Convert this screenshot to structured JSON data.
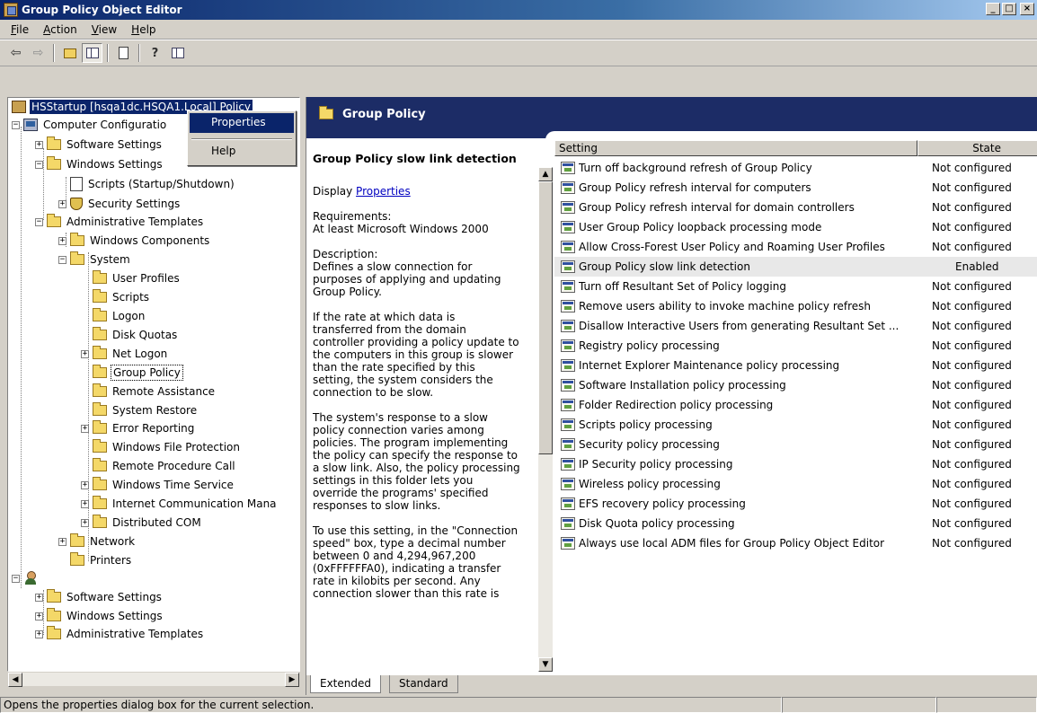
{
  "window": {
    "title": "Group Policy Object Editor",
    "controls": [
      "_",
      "□",
      "×"
    ]
  },
  "menu": [
    {
      "label": "File",
      "accel": "F",
      "rest": "ile"
    },
    {
      "label": "Action",
      "accel": "A",
      "rest": "ction"
    },
    {
      "label": "View",
      "accel": "V",
      "rest": "iew"
    },
    {
      "label": "Help",
      "accel": "H",
      "rest": "elp"
    }
  ],
  "toolbar": {
    "back": "⇦",
    "forward": "⇨",
    "up_icon": "folder-up-icon",
    "show_hide_tree_icon": "show-hide-console-tree-icon",
    "export_icon": "export-list-icon",
    "help_icon": "help-icon",
    "pane_icon": "show-hide-action-pane-icon"
  },
  "tree": {
    "root": "HSStartup [hsqa1dc.HSQA1.Local] Policy",
    "computer_configuration": "Computer Configuratio",
    "nodes": {
      "software_settings": "Software Settings",
      "windows_settings": "Windows Settings",
      "scripts_startup": "Scripts (Startup/Shutdown)",
      "security_settings": "Security Settings",
      "administrative_templates": "Administrative Templates",
      "windows_components": "Windows Components",
      "system": "System",
      "user_profiles": "User Profiles",
      "scripts": "Scripts",
      "logon": "Logon",
      "disk_quotas": "Disk Quotas",
      "net_logon": "Net Logon",
      "group_policy": "Group Policy",
      "remote_assistance": "Remote Assistance",
      "system_restore": "System Restore",
      "error_reporting": "Error Reporting",
      "windows_file_protection": "Windows File Protection",
      "remote_procedure_call": "Remote Procedure Call",
      "windows_time_service": "Windows Time Service",
      "internet_communication": "Internet Communication Mana",
      "distributed_com": "Distributed COM",
      "network": "Network",
      "printers": "Printers",
      "user_configuration": "User Configuration",
      "user_software_settings": "Software Settings",
      "user_windows_settings": "Windows Settings",
      "user_administrative_templates": "Administrative Templates"
    }
  },
  "context_menu": {
    "properties": "Properties",
    "help": "Help"
  },
  "right_pane": {
    "banner_title": "Group Policy",
    "description": {
      "title": "Group Policy slow link detection",
      "display_prefix": "Display ",
      "display_link": "Properties",
      "requirements": "Requirements:\nAt least Microsoft Windows 2000",
      "description": "Description:\nDefines a slow connection for\npurposes of applying and updating\nGroup Policy.",
      "para2": "If the rate at which data is\ntransferred from the domain\ncontroller providing a policy update to\nthe computers in this group is slower\nthan the rate specified by this\nsetting, the system considers the\nconnection to be slow.",
      "para3": "The system's response to a slow\npolicy connection varies among\npolicies. The program implementing\nthe policy can specify the response to\na slow link. Also, the policy processing\nsettings in this folder lets you\noverride the programs' specified\nresponses to slow links.",
      "para4": "To use this setting, in the \"Connection\nspeed\" box, type a decimal number\nbetween 0 and 4,294,967,200\n(0xFFFFFFA0), indicating a transfer\nrate in kilobits per second. Any\nconnection slower than this rate is"
    },
    "columns": {
      "setting": "Setting",
      "state": "State"
    },
    "settings": [
      {
        "name": "Turn off background refresh of Group Policy",
        "state": "Not configured"
      },
      {
        "name": "Group Policy refresh interval for computers",
        "state": "Not configured"
      },
      {
        "name": "Group Policy refresh interval for domain controllers",
        "state": "Not configured"
      },
      {
        "name": "User Group Policy loopback processing mode",
        "state": "Not configured"
      },
      {
        "name": "Allow Cross-Forest User Policy and Roaming User Profiles",
        "state": "Not configured"
      },
      {
        "name": "Group Policy slow link detection",
        "state": "Enabled"
      },
      {
        "name": "Turn off Resultant Set of Policy logging",
        "state": "Not configured"
      },
      {
        "name": "Remove users ability to invoke machine policy refresh",
        "state": "Not configured"
      },
      {
        "name": "Disallow Interactive Users from generating Resultant Set ...",
        "state": "Not configured"
      },
      {
        "name": "Registry policy processing",
        "state": "Not configured"
      },
      {
        "name": "Internet Explorer Maintenance policy processing",
        "state": "Not configured"
      },
      {
        "name": "Software Installation policy processing",
        "state": "Not configured"
      },
      {
        "name": "Folder Redirection policy processing",
        "state": "Not configured"
      },
      {
        "name": "Scripts policy processing",
        "state": "Not configured"
      },
      {
        "name": "Security policy processing",
        "state": "Not configured"
      },
      {
        "name": "IP Security policy processing",
        "state": "Not configured"
      },
      {
        "name": "Wireless policy processing",
        "state": "Not configured"
      },
      {
        "name": "EFS recovery policy processing",
        "state": "Not configured"
      },
      {
        "name": "Disk Quota policy processing",
        "state": "Not configured"
      },
      {
        "name": "Always use local ADM files for Group Policy Object Editor",
        "state": "Not configured"
      }
    ],
    "tabs": [
      "Extended",
      "Standard"
    ]
  },
  "status": {
    "text": "Opens the properties dialog box for the current selection."
  }
}
